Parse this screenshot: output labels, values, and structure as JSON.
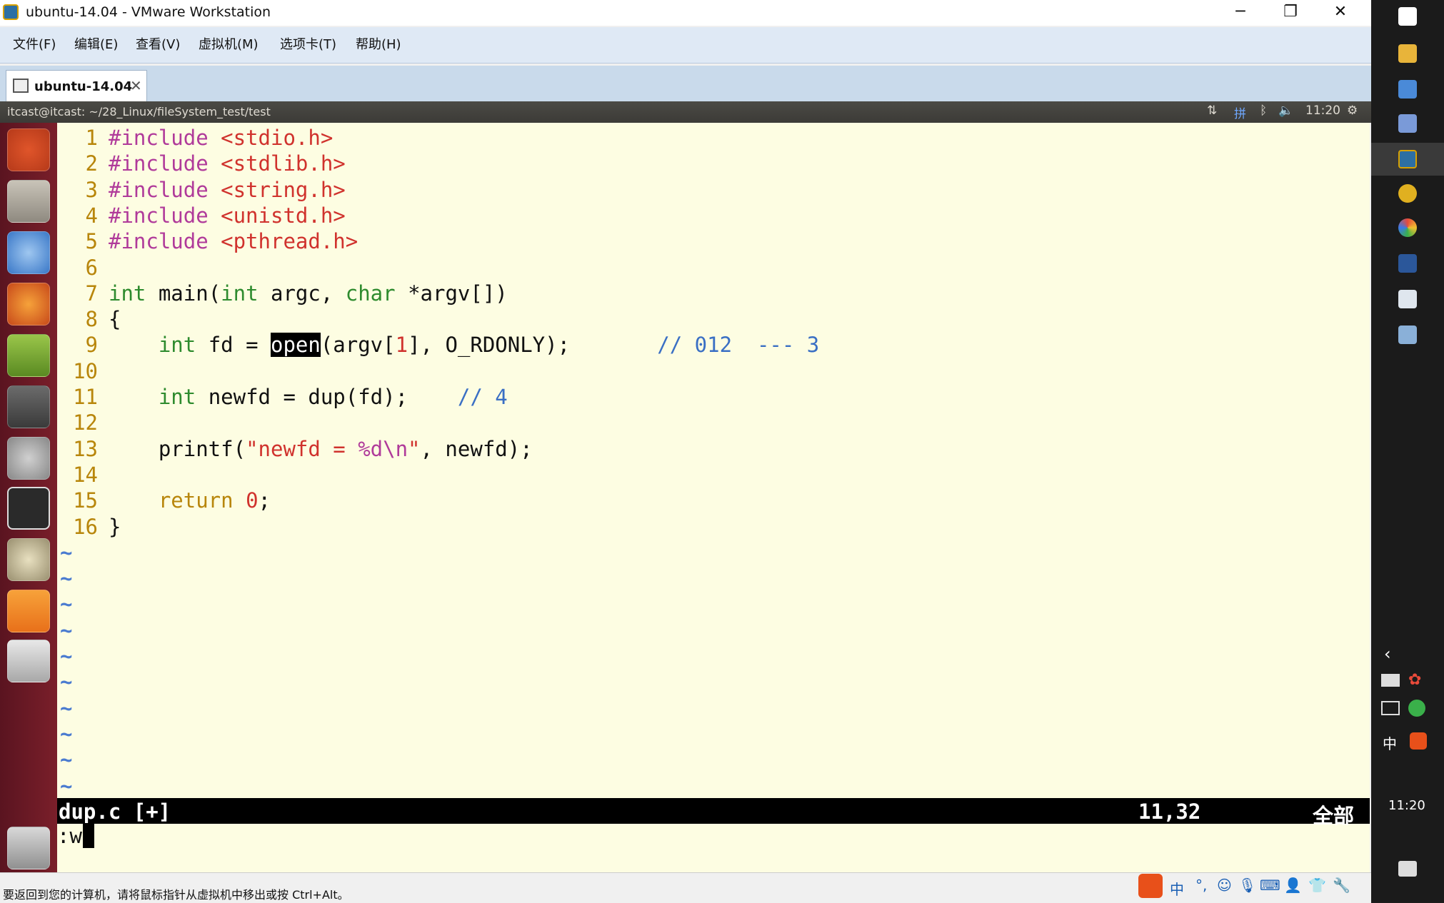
{
  "window": {
    "title": "ubuntu-14.04 - VMware Workstation",
    "minimize": "─",
    "restore": "❐",
    "close": "✕"
  },
  "menu": [
    "文件(F)",
    "编辑(E)",
    "查看(V)",
    "虚拟机(M)",
    "选项卡(T)",
    "帮助(H)"
  ],
  "tab": {
    "label": "ubuntu-14.04",
    "close": "✕"
  },
  "ubuntu_panel": {
    "title": "itcast@itcast: ~/28_Linux/fileSystem_test/test",
    "time": "11:20",
    "ime": "拼"
  },
  "code_lines": [
    {
      "n": "1",
      "parts": [
        [
          "pp",
          "#include "
        ],
        [
          "hdr",
          "<stdio.h>"
        ]
      ]
    },
    {
      "n": "2",
      "parts": [
        [
          "pp",
          "#include "
        ],
        [
          "hdr",
          "<stdlib.h>"
        ]
      ]
    },
    {
      "n": "3",
      "parts": [
        [
          "pp",
          "#include "
        ],
        [
          "hdr",
          "<string.h>"
        ]
      ]
    },
    {
      "n": "4",
      "parts": [
        [
          "pp",
          "#include "
        ],
        [
          "hdr",
          "<unistd.h>"
        ]
      ]
    },
    {
      "n": "5",
      "parts": [
        [
          "pp",
          "#include "
        ],
        [
          "hdr",
          "<pthread.h>"
        ]
      ]
    },
    {
      "n": "6",
      "parts": []
    },
    {
      "n": "7",
      "parts": [
        [
          "ty",
          "int"
        ],
        [
          "",
          " main("
        ],
        [
          "ty",
          "int"
        ],
        [
          "",
          " argc, "
        ],
        [
          "ty",
          "char"
        ],
        [
          "",
          " *argv[])"
        ]
      ]
    },
    {
      "n": "8",
      "parts": [
        [
          "",
          "{"
        ]
      ]
    },
    {
      "n": "9",
      "parts": [
        [
          "",
          "    "
        ],
        [
          "ty",
          "int"
        ],
        [
          "",
          " fd = "
        ],
        [
          "sel",
          "open"
        ],
        [
          "",
          "(argv["
        ],
        [
          "num",
          "1"
        ],
        [
          "",
          "], O_RDONLY);       "
        ],
        [
          "cm",
          "// 012  --- 3"
        ]
      ]
    },
    {
      "n": "10",
      "parts": []
    },
    {
      "n": "11",
      "parts": [
        [
          "",
          "    "
        ],
        [
          "ty",
          "int"
        ],
        [
          "",
          " newfd = dup(fd);    "
        ],
        [
          "cm",
          "// 4"
        ]
      ]
    },
    {
      "n": "12",
      "parts": []
    },
    {
      "n": "13",
      "parts": [
        [
          "",
          "    printf("
        ],
        [
          "str",
          "\"newfd = "
        ],
        [
          "pp",
          "%d\\n"
        ],
        [
          "str",
          "\""
        ],
        [
          "",
          ", newfd);"
        ]
      ]
    },
    {
      "n": "14",
      "parts": []
    },
    {
      "n": "15",
      "parts": [
        [
          "",
          "    "
        ],
        [
          "kw",
          "return"
        ],
        [
          "",
          " "
        ],
        [
          "num",
          "0"
        ],
        [
          "",
          ";"
        ]
      ]
    },
    {
      "n": "16",
      "parts": [
        [
          "",
          "}"
        ]
      ]
    }
  ],
  "tilde": "~",
  "vim_status": {
    "file": "dup.c [+]",
    "pos": "11,32",
    "scroll": "全部"
  },
  "vim_cmd": ":wq",
  "vmware_status": "要返回到您的计算机，请将鼠标指针从虚拟机中移出或按 Ctrl+Alt。",
  "tray_ime": "中",
  "taskbar_time": "11:20",
  "colors": {
    "launcher": "#6b1a24",
    "vim_bg": "#fdfde2",
    "taskbar": "#1b1b1b"
  }
}
